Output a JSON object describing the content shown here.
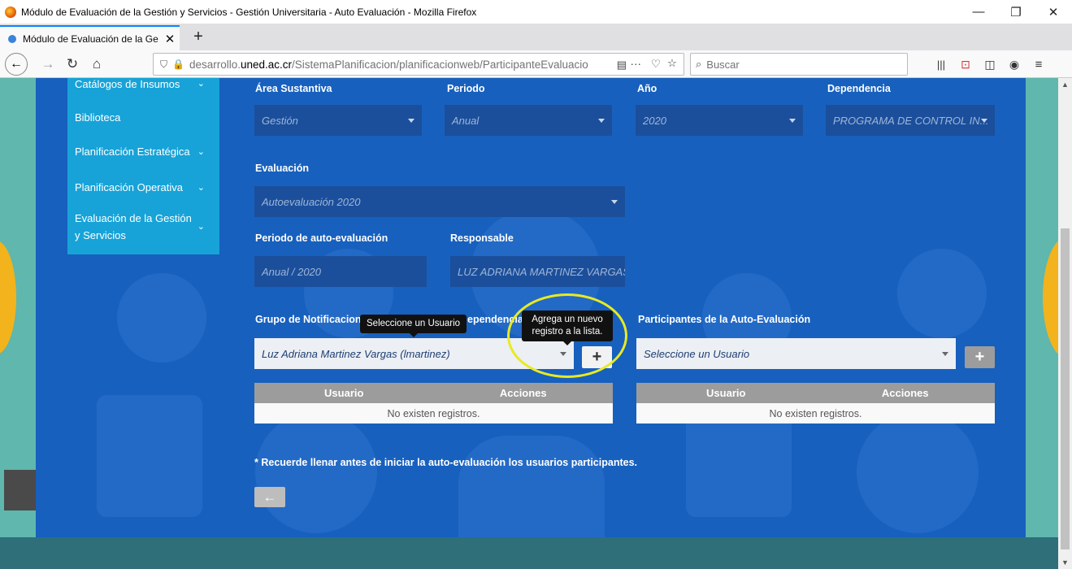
{
  "window": {
    "title": "Módulo de Evaluación de la Gestión y Servicios - Gestión Universitaria - Auto Evaluación - Mozilla Firefox",
    "minimize": "—",
    "restore": "❐",
    "close": "✕"
  },
  "browser": {
    "tab_title": "Módulo de Evaluación de la Ge",
    "tab_close": "✕",
    "new_tab": "+",
    "url_prefix": "desarrollo.",
    "url_host": "uned.ac.cr",
    "url_path": "/SistemaPlanificacion/planificacionweb/ParticipanteEvaluacio",
    "search_placeholder": "Buscar",
    "overflow_menu": "···"
  },
  "sidebar": {
    "items": [
      {
        "label": "Catálogos de Insumos",
        "chevron": "⌄"
      },
      {
        "label": "Biblioteca",
        "chevron": ""
      },
      {
        "label": "Planificación Estratégica",
        "chevron": "⌄"
      },
      {
        "label": "Planificación Operativa",
        "chevron": "⌄"
      },
      {
        "label": "Evaluación de la Gestión y Servicios",
        "chevron": "⌄"
      }
    ]
  },
  "form": {
    "area_label": "Área Sustantiva",
    "area_value": "Gestión",
    "periodo_label": "Periodo",
    "periodo_value": "Anual",
    "anio_label": "Año",
    "anio_value": "2020",
    "dependencia_label": "Dependencia",
    "dependencia_value": "PROGRAMA DE CONTROL IN...",
    "evaluacion_label": "Evaluación",
    "evaluacion_value": "Autoevaluación 2020",
    "periodo_auto_label": "Periodo de auto-evaluación",
    "periodo_auto_value": "Anual / 2020",
    "responsable_label": "Responsable",
    "responsable_value": "LUZ ADRIANA MARTINEZ VARGAS",
    "grupo_label_left": "Grupo de Notificacione",
    "grupo_label_right": "ependencia",
    "grupo_select_value": "Luz Adriana Martinez Vargas (lmartinez)",
    "participantes_label": "Participantes de la Auto-Evaluación",
    "participantes_select_value": "Seleccione un Usuario",
    "plus_label": "+",
    "table_col_user": "Usuario",
    "table_col_actions": "Acciones",
    "table_empty": "No existen registros.",
    "note": "* Recuerde llenar antes de iniciar la auto-evaluación los usuarios participantes.",
    "back_arrow": "←"
  },
  "tooltips": {
    "user": "Seleccione un Usuario",
    "add_line1": "Agrega un nuevo",
    "add_line2": "registro a la lista."
  }
}
